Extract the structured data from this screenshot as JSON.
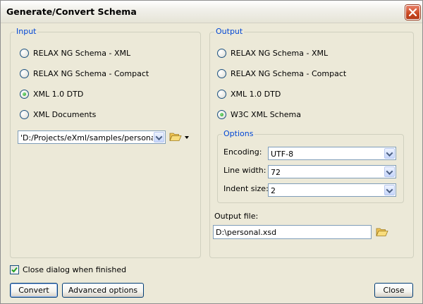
{
  "window": {
    "title": "Generate/Convert Schema"
  },
  "input": {
    "group_label": "Input",
    "options": [
      {
        "label": "RELAX NG Schema - XML",
        "checked": false
      },
      {
        "label": "RELAX NG Schema - Compact",
        "checked": false
      },
      {
        "label": "XML 1.0 DTD",
        "checked": true
      },
      {
        "label": "XML Documents",
        "checked": false
      }
    ],
    "file_value": "'D:/Projects/eXml/samples/personal.dtd"
  },
  "output": {
    "group_label": "Output",
    "options": [
      {
        "label": "RELAX NG Schema - XML",
        "checked": false
      },
      {
        "label": "RELAX NG Schema - Compact",
        "checked": false
      },
      {
        "label": "XML 1.0 DTD",
        "checked": false
      },
      {
        "label": "W3C XML Schema",
        "checked": true
      }
    ],
    "options_group": {
      "label": "Options",
      "encoding_label": "Encoding:",
      "encoding_value": "UTF-8",
      "line_width_label": "Line width:",
      "line_width_value": "72",
      "indent_label": "Indent size:",
      "indent_value": "2"
    },
    "file_label": "Output file:",
    "file_value": "D:\\personal.xsd"
  },
  "close_when_finished": {
    "label": "Close dialog when finished",
    "checked": true
  },
  "buttons": {
    "convert": "Convert",
    "advanced": "Advanced options",
    "close": "Close"
  },
  "icons": {
    "title_close": "close-icon",
    "folder": "folder-open-icon",
    "dropdown": "triangle-down-icon"
  }
}
